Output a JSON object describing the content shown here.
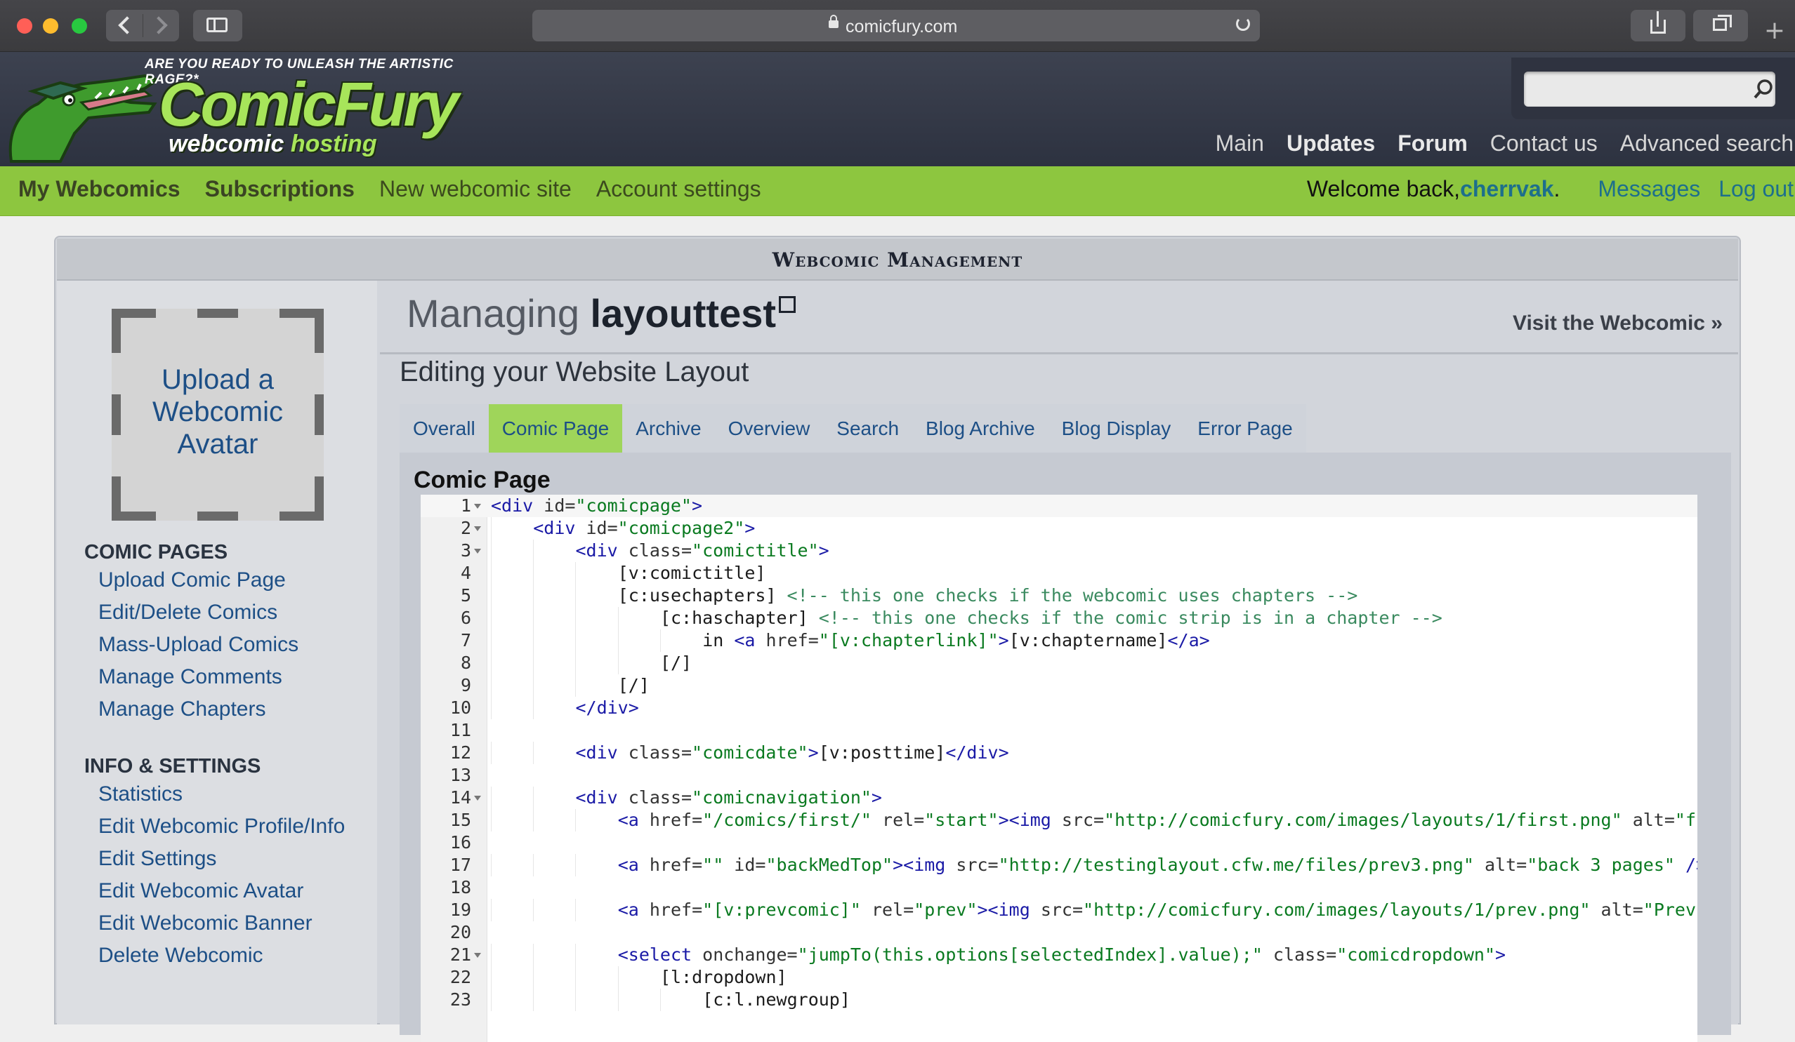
{
  "browser": {
    "url": "comicfury.com",
    "new_tab": "+"
  },
  "site": {
    "tagline": "ARE YOU READY TO UNLEASH THE ARTISTIC RAGE?*",
    "logo_title": "ComicFury",
    "logo_sub_a": "webcomic ",
    "logo_sub_b": "hosting",
    "search_placeholder": "",
    "top_nav": [
      "Main",
      "Updates",
      "Forum",
      "Contact us",
      "Advanced search"
    ]
  },
  "userbar": {
    "left": [
      "My Webcomics",
      "Subscriptions",
      "New webcomic site",
      "Account settings"
    ],
    "welcome": "Welcome back, ",
    "username": "cherrvak",
    "dot": ".",
    "messages": "Messages",
    "logout": "Log out"
  },
  "panel": {
    "title": "Webcomic Management"
  },
  "sidebar": {
    "avatar_text": "Upload a Webcomic Avatar",
    "comic_pages_heading": "COMIC PAGES",
    "comic_pages": [
      "Upload Comic Page",
      "Edit/Delete Comics",
      "Mass-Upload Comics",
      "Manage Comments",
      "Manage Chapters"
    ],
    "info_heading": "INFO & SETTINGS",
    "info": [
      "Statistics",
      "Edit Webcomic Profile/Info",
      "Edit Settings",
      "Edit Webcomic Avatar",
      "Edit Webcomic Banner",
      "Delete Webcomic"
    ]
  },
  "main": {
    "managing_label": "Managing ",
    "comic_name": "layouttest",
    "visit_link": "Visit the Webcomic »",
    "edit_heading": "Editing your Website Layout",
    "tabs": [
      "Overall",
      "Comic Page",
      "Archive",
      "Overview",
      "Search",
      "Blog Archive",
      "Blog Display",
      "Error Page"
    ],
    "active_tab": "Comic Page",
    "section_title": "Comic Page"
  },
  "editor": {
    "lines": [
      {
        "n": "1",
        "fold": true,
        "indent": 0,
        "segs": [
          [
            "tag",
            "<div "
          ],
          [
            "attr",
            "id="
          ],
          [
            "str",
            "\"comicpage\""
          ],
          [
            "tag",
            ">"
          ]
        ]
      },
      {
        "n": "2",
        "fold": true,
        "indent": 1,
        "segs": [
          [
            "tag",
            "<div "
          ],
          [
            "attr",
            "id="
          ],
          [
            "str",
            "\"comicpage2\""
          ],
          [
            "tag",
            ">"
          ]
        ]
      },
      {
        "n": "3",
        "fold": true,
        "indent": 2,
        "segs": [
          [
            "tag",
            "<div "
          ],
          [
            "attr",
            "class="
          ],
          [
            "str",
            "\"comictitle\""
          ],
          [
            "tag",
            ">"
          ]
        ]
      },
      {
        "n": "4",
        "fold": false,
        "indent": 3,
        "segs": [
          [
            "txt",
            "[v:comictitle]"
          ]
        ]
      },
      {
        "n": "5",
        "fold": false,
        "indent": 3,
        "segs": [
          [
            "txt",
            "[c:usechapters] "
          ],
          [
            "cmt",
            "<!-- this one checks if the webcomic uses chapters -->"
          ]
        ]
      },
      {
        "n": "6",
        "fold": false,
        "indent": 4,
        "segs": [
          [
            "txt",
            "[c:haschapter] "
          ],
          [
            "cmt",
            "<!-- this one checks if the comic strip is in a chapter -->"
          ]
        ]
      },
      {
        "n": "7",
        "fold": false,
        "indent": 5,
        "segs": [
          [
            "txt",
            "in "
          ],
          [
            "tag",
            "<a "
          ],
          [
            "attr",
            "href="
          ],
          [
            "str",
            "\"[v:chapterlink]\""
          ],
          [
            "tag",
            ">"
          ],
          [
            "txt",
            "[v:chaptername]"
          ],
          [
            "tag",
            "</a>"
          ]
        ]
      },
      {
        "n": "8",
        "fold": false,
        "indent": 4,
        "segs": [
          [
            "txt",
            "[/]"
          ]
        ]
      },
      {
        "n": "9",
        "fold": false,
        "indent": 3,
        "segs": [
          [
            "txt",
            "[/]"
          ]
        ]
      },
      {
        "n": "10",
        "fold": false,
        "indent": 2,
        "segs": [
          [
            "tag",
            "</div>"
          ]
        ]
      },
      {
        "n": "11",
        "fold": false,
        "indent": 0,
        "segs": []
      },
      {
        "n": "12",
        "fold": false,
        "indent": 2,
        "segs": [
          [
            "tag",
            "<div "
          ],
          [
            "attr",
            "class="
          ],
          [
            "str",
            "\"comicdate\""
          ],
          [
            "tag",
            ">"
          ],
          [
            "txt",
            "[v:posttime]"
          ],
          [
            "tag",
            "</div>"
          ]
        ]
      },
      {
        "n": "13",
        "fold": false,
        "indent": 0,
        "segs": []
      },
      {
        "n": "14",
        "fold": true,
        "indent": 2,
        "segs": [
          [
            "tag",
            "<div "
          ],
          [
            "attr",
            "class="
          ],
          [
            "str",
            "\"comicnavigation\""
          ],
          [
            "tag",
            ">"
          ]
        ]
      },
      {
        "n": "15",
        "fold": false,
        "indent": 3,
        "segs": [
          [
            "tag",
            "<a "
          ],
          [
            "attr",
            "href="
          ],
          [
            "str",
            "\"/comics/first/\""
          ],
          [
            "attr",
            " rel="
          ],
          [
            "str",
            "\"start\""
          ],
          [
            "tag",
            "><img "
          ],
          [
            "attr",
            "src="
          ],
          [
            "str",
            "\"http://comicfury.com/images/layouts/1/first.png\""
          ],
          [
            "attr",
            " alt="
          ],
          [
            "str",
            "\"first\""
          ]
        ]
      },
      {
        "n": "16",
        "fold": false,
        "indent": 0,
        "segs": []
      },
      {
        "n": "17",
        "fold": false,
        "indent": 3,
        "segs": [
          [
            "tag",
            "<a "
          ],
          [
            "attr",
            "href="
          ],
          [
            "str",
            "\"\""
          ],
          [
            "attr",
            " id="
          ],
          [
            "str",
            "\"backMedTop\""
          ],
          [
            "tag",
            "><img "
          ],
          [
            "attr",
            "src="
          ],
          [
            "str",
            "\"http://testinglayout.cfw.me/files/prev3.png\""
          ],
          [
            "attr",
            " alt="
          ],
          [
            "str",
            "\"back 3 pages\""
          ],
          [
            "tag",
            " /></a>"
          ]
        ]
      },
      {
        "n": "18",
        "fold": false,
        "indent": 0,
        "segs": []
      },
      {
        "n": "19",
        "fold": false,
        "indent": 3,
        "segs": [
          [
            "tag",
            "<a "
          ],
          [
            "attr",
            "href="
          ],
          [
            "str",
            "\"[v:prevcomic]\""
          ],
          [
            "attr",
            " rel="
          ],
          [
            "str",
            "\"prev\""
          ],
          [
            "tag",
            "><img "
          ],
          [
            "attr",
            "src="
          ],
          [
            "str",
            "\"http://comicfury.com/images/layouts/1/prev.png\""
          ],
          [
            "attr",
            " alt="
          ],
          [
            "str",
            "\"Previous\""
          ]
        ]
      },
      {
        "n": "20",
        "fold": false,
        "indent": 0,
        "segs": []
      },
      {
        "n": "21",
        "fold": true,
        "indent": 3,
        "segs": [
          [
            "tag",
            "<select "
          ],
          [
            "attr",
            "onchange="
          ],
          [
            "str",
            "\"jumpTo(this.options[selectedIndex].value);\""
          ],
          [
            "attr",
            " class="
          ],
          [
            "str",
            "\"comicdropdown\""
          ],
          [
            "tag",
            ">"
          ]
        ]
      },
      {
        "n": "22",
        "fold": false,
        "indent": 4,
        "segs": [
          [
            "txt",
            "[l:dropdown]"
          ]
        ]
      },
      {
        "n": "23",
        "fold": false,
        "indent": 5,
        "segs": [
          [
            "txt",
            "[c:l.newgroup]"
          ]
        ]
      }
    ]
  },
  "colors": {
    "green_bar": "#8dc63f",
    "active_tab": "#9fd55a",
    "link": "#1d4f86",
    "header_bg": "#343947"
  }
}
